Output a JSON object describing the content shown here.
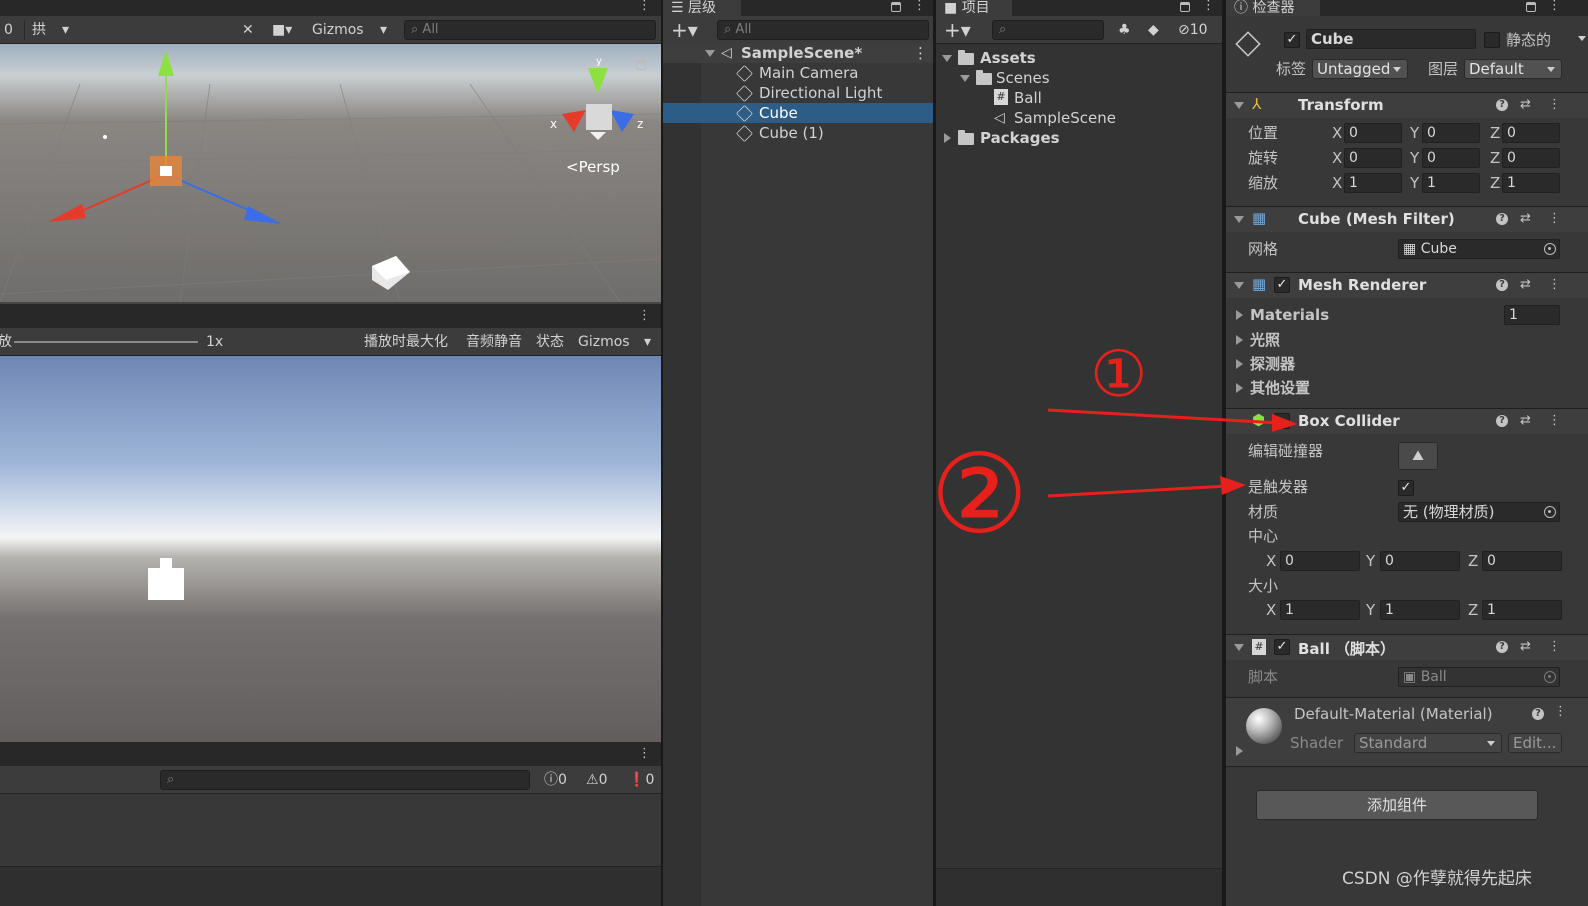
{
  "scene_view": {
    "toolbar": {
      "left_num": "0",
      "grid_label": "拱",
      "gizmos": "Gizmos",
      "search_placeholder": "All"
    },
    "persp_label": "<Persp",
    "axis_x": "x",
    "axis_z": "z",
    "axis_y": "y"
  },
  "game_view": {
    "toolbar": {
      "scale_prefix": "放",
      "scale_value": "1x",
      "maximize_on_play": "播放时最大化",
      "mute_audio": "音频静音",
      "stats": "状态",
      "gizmos": "Gizmos"
    }
  },
  "console": {
    "counts": {
      "info": "0",
      "warn": "0",
      "error": "0"
    }
  },
  "hierarchy": {
    "tab": "层级",
    "search_placeholder": "All",
    "scene": "SampleScene*",
    "items": [
      {
        "label": "Main Camera"
      },
      {
        "label": "Directional Light"
      },
      {
        "label": "Cube"
      },
      {
        "label": "Cube (1)"
      }
    ]
  },
  "project": {
    "tab": "项目",
    "hidden_count": "10",
    "tree": {
      "assets": "Assets",
      "scenes": "Scenes",
      "ball": "Ball",
      "sample_scene": "SampleScene",
      "packages": "Packages"
    }
  },
  "inspector": {
    "tab": "检查器",
    "object_name": "Cube",
    "static_label": "静态的",
    "tag_label": "标签",
    "tag_value": "Untagged",
    "layer_label": "图层",
    "layer_value": "Default",
    "transform": {
      "title": "Transform",
      "position_label": "位置",
      "rotation_label": "旋转",
      "scale_label": "缩放",
      "position": [
        "0",
        "0",
        "0"
      ],
      "rotation": [
        "0",
        "0",
        "0"
      ],
      "scale": [
        "1",
        "1",
        "1"
      ]
    },
    "mesh_filter": {
      "title": "Cube (Mesh Filter)",
      "mesh_label": "网格",
      "mesh_value": "Cube"
    },
    "mesh_renderer": {
      "title": "Mesh Renderer",
      "materials_label": "Materials",
      "materials_count": "1",
      "lighting": "光照",
      "probes": "探测器",
      "other": "其他设置"
    },
    "box_collider": {
      "title": "Box Collider",
      "edit_label": "编辑碰撞器",
      "is_trigger_label": "是触发器",
      "material_label": "材质",
      "material_value": "无 (物理材质)",
      "center_label": "中心",
      "center": [
        "0",
        "0",
        "0"
      ],
      "size_label": "大小",
      "size": [
        "1",
        "1",
        "1"
      ]
    },
    "ball_script": {
      "title": "Ball （脚本）",
      "script_label": "脚本",
      "script_value": "Ball"
    },
    "material": {
      "title": "Default-Material (Material)",
      "shader_label": "Shader",
      "shader_value": "Standard",
      "edit_label": "Edit..."
    },
    "add_component": "添加组件"
  },
  "axis_labels": {
    "x": "X",
    "y": "Y",
    "z": "Z"
  },
  "annotations": {
    "one": "①",
    "two": "②"
  },
  "watermark": "CSDN @作孽就得先起床"
}
